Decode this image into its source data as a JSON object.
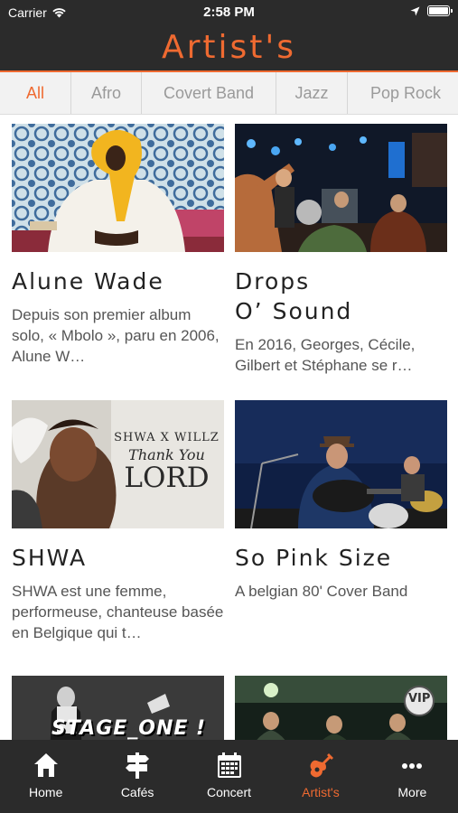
{
  "status_bar": {
    "carrier": "Carrier",
    "time": "2:58 PM"
  },
  "header": {
    "title": "Artist's",
    "accent_color": "#ef6a31"
  },
  "filters": [
    {
      "label": "All",
      "active": true
    },
    {
      "label": "Afro",
      "active": false
    },
    {
      "label": "Covert Band",
      "active": false
    },
    {
      "label": "Jazz",
      "active": false
    },
    {
      "label": "Pop Rock",
      "active": false
    }
  ],
  "artists": [
    {
      "name": "Alune Wade",
      "description": "Depuis son premier album solo, « Mbolo », paru en 2006, Alune W…"
    },
    {
      "name": "Drops\nO’ Sound",
      "description": "En 2016, Georges, Cécile, Gilbert et Stéphane se r…"
    },
    {
      "name": "SHWA",
      "description": "SHWA est une femme, performeuse, chanteuse basée en Belgique qui t…",
      "image_text": [
        "SHWA X WILLZ",
        "Thank You",
        "LORD"
      ]
    },
    {
      "name": "So Pink Size",
      "description": "A belgian 80' Cover Band"
    },
    {
      "name": "",
      "description": "",
      "image_text": [
        "STAGE_ONE !"
      ]
    },
    {
      "name": "",
      "description": "",
      "image_text": [
        "VIP"
      ]
    }
  ],
  "bottom_nav": [
    {
      "label": "Home",
      "icon": "home-icon",
      "active": false
    },
    {
      "label": "Cafés",
      "icon": "signpost-icon",
      "active": false
    },
    {
      "label": "Concert",
      "icon": "calendar-icon",
      "active": false
    },
    {
      "label": "Artist's",
      "icon": "guitar-icon",
      "active": true
    },
    {
      "label": "More",
      "icon": "more-icon",
      "active": false
    }
  ]
}
